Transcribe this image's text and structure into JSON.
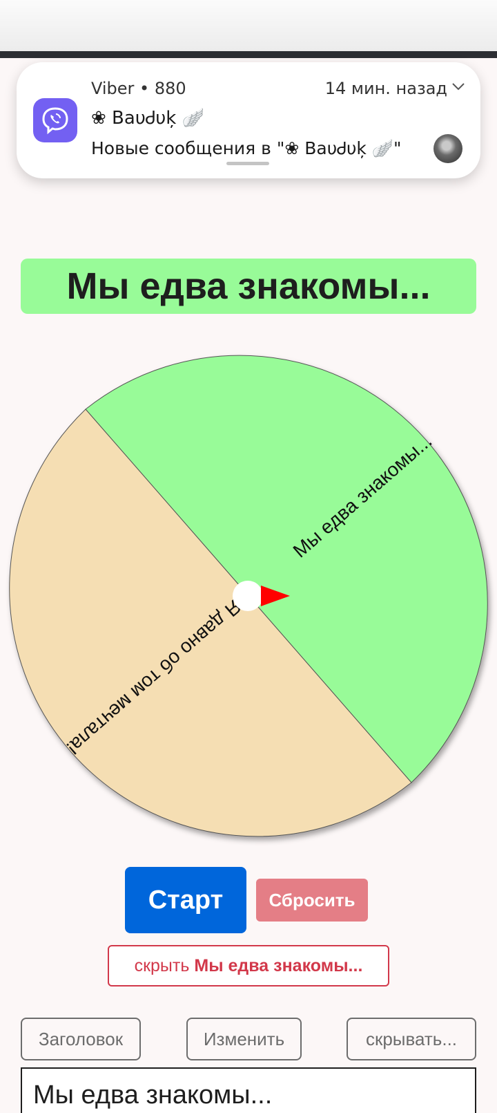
{
  "notification": {
    "app_name": "Viber • 880",
    "time": "14 мин. назад",
    "sender": "❀ ВаυᏧυķ 🪽",
    "message": "Новые сообщения в \"❀ ВаυᏧυķ 🪽\"",
    "icon": "viber-icon",
    "accent_color": "#7360f2"
  },
  "result": {
    "text": "Мы едва знакомы..."
  },
  "wheel": {
    "segments": [
      {
        "label": "Мы едва знакомы...",
        "color": "#98fb98"
      },
      {
        "label": "Я давно об том мечтала!",
        "color": "#f5deb3"
      }
    ],
    "pointer_color": "#ff0000"
  },
  "controls": {
    "start_label": "Старт",
    "reset_label": "Сбросить",
    "hide_prefix": "скрыть",
    "hide_target": "Мы едва знакомы...",
    "title_label": "Заголовок",
    "edit_label": "Изменить",
    "hide_label": "скрывать..."
  },
  "editor": {
    "text": "Мы едва знакомы...\nЯ давно об том мечтала!"
  }
}
